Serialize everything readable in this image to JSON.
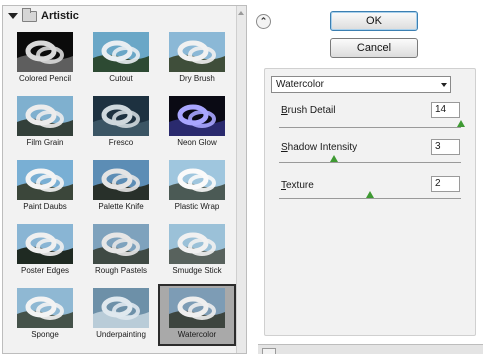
{
  "gallery": {
    "category": "Artistic",
    "filters": [
      {
        "label": "Colored Pencil"
      },
      {
        "label": "Cutout"
      },
      {
        "label": "Dry Brush"
      },
      {
        "label": "Film Grain"
      },
      {
        "label": "Fresco"
      },
      {
        "label": "Neon Glow"
      },
      {
        "label": "Paint Daubs"
      },
      {
        "label": "Palette Knife"
      },
      {
        "label": "Plastic Wrap"
      },
      {
        "label": "Poster Edges"
      },
      {
        "label": "Rough Pastels"
      },
      {
        "label": "Smudge Stick"
      },
      {
        "label": "Sponge"
      },
      {
        "label": "Underpainting"
      },
      {
        "label": "Watercolor"
      }
    ],
    "selected": "Watercolor"
  },
  "buttons": {
    "ok": "OK",
    "cancel": "Cancel"
  },
  "filter_select": {
    "value": "Watercolor"
  },
  "params": {
    "brush_detail": {
      "first": "B",
      "rest": "rush Detail",
      "value": "14",
      "level": 1.0
    },
    "shadow_intensity": {
      "first": "S",
      "rest": "hadow Intensity",
      "value": "3",
      "level": 0.3
    },
    "texture": {
      "first": "T",
      "rest": "exture",
      "value": "2",
      "level": 0.5
    }
  },
  "colors": {
    "selected_cell": "#a9a9a9",
    "slider_knob": "#3f9a33",
    "ok_focus": "#3c7fb1"
  }
}
